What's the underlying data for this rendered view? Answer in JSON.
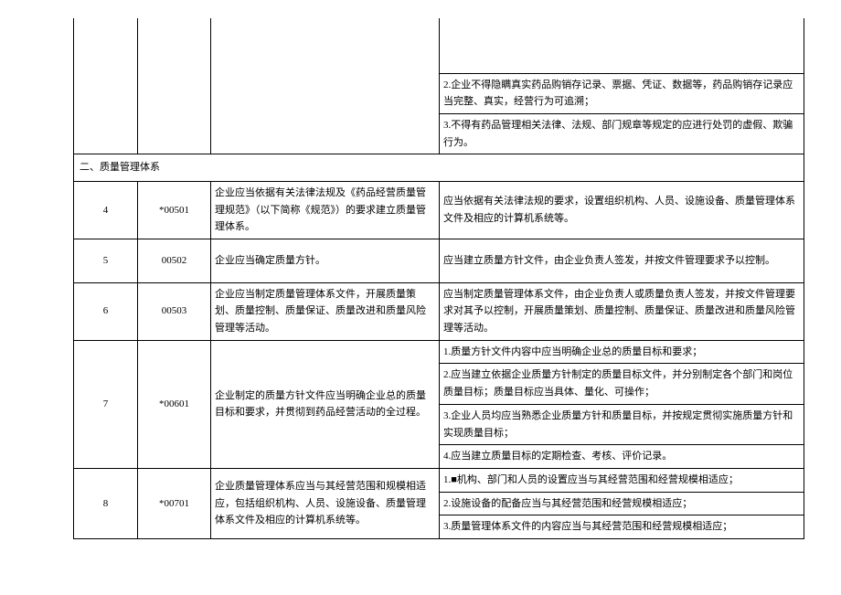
{
  "blank_row": {
    "c1": "",
    "c2": "",
    "c3": "",
    "d1": "",
    "d2": "2.企业不得隐瞒真实药品购销存记录、票据、凭证、数据等，药品购销存记录应当完整、真实，经营行为可追溯；",
    "d3": "3.不得有药品管理相关法律、法规、部门规章等规定的应进行处罚的虚假、欺骗行为。"
  },
  "section_title": "二、质量管理体系",
  "rows": [
    {
      "num": "4",
      "code": "*00501",
      "req": "企业应当依据有关法律法规及《药品经营质量管理规范》（以下简称《规范》）的要求建立质量管理体系。",
      "details": [
        "应当依据有关法律法规的要求，设置组织机构、人员、设施设备、质量管理体系文件及相应的计算机系统等。"
      ]
    },
    {
      "num": "5",
      "code": "00502",
      "req": "企业应当确定质量方针。",
      "details": [
        "应当建立质量方针文件，由企业负责人签发，并按文件管理要求予以控制。"
      ]
    },
    {
      "num": "6",
      "code": "00503",
      "req": "企业应当制定质量管理体系文件，开展质量策划、质量控制、质量保证、质量改进和质量风险管理等活动。",
      "details": [
        "应当制定质量管理体系文件，由企业负责人或质量负责人签发，并按文件管理要求对其予以控制，开展质量策划、质量控制、质量保证、质量改进和质量风险管理等活动。"
      ]
    },
    {
      "num": "7",
      "code": "*00601",
      "req": "企业制定的质量方针文件应当明确企业总的质量目标和要求，并贯彻到药品经营活动的全过程。",
      "details": [
        "1.质量方针文件内容中应当明确企业总的质量目标和要求；",
        "2.应当建立依据企业质量方针制定的质量目标文件，并分别制定各个部门和岗位质量目标；质量目标应当具体、量化、可操作；",
        "3.企业人员均应当熟悉企业质量方针和质量目标，并按规定贯彻实施质量方针和实现质量目标；",
        "4.应当建立质量目标的定期检查、考核、评价记录。"
      ]
    },
    {
      "num": "8",
      "code": "*00701",
      "req": "企业质量管理体系应当与其经营范围和规模相适应，包括组织机构、人员、设施设备、质量管理体系文件及相应的计算机系统等。",
      "details": [
        "1.■机构、部门和人员的设置应当与其经营范围和经营规模相适应；",
        "2.设施设备的配备应当与其经营范围和经营规模相适应；",
        "3.质量管理体系文件的内容应当与其经营范围和经营规模相适应；"
      ]
    }
  ]
}
